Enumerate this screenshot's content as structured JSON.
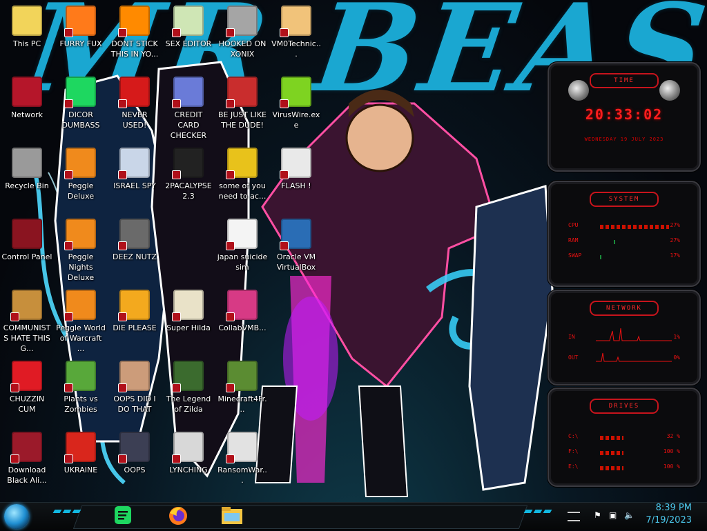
{
  "desktop": {
    "wallpaper_text": "MR BEAST",
    "icons": [
      {
        "label": "This PC",
        "icon": "this-pc-icon"
      },
      {
        "label": "FURRY FUX",
        "icon": "firefox-icon"
      },
      {
        "label": "DONT STICK THIS IN YO...",
        "icon": "vlc-icon"
      },
      {
        "label": "SEX EDITOR",
        "icon": "hex-editor-icon"
      },
      {
        "label": "HOOKED ON XONIX",
        "icon": "xonix-icon"
      },
      {
        "label": "VM0Technic...",
        "icon": "technician-icon"
      },
      {
        "label": "Network",
        "icon": "network-icon"
      },
      {
        "label": "DICOR DUMBASS",
        "icon": "discord-icon"
      },
      {
        "label": "NEVER USED!",
        "icon": "devcpp-icon"
      },
      {
        "label": "CREDIT CARD CHECKER",
        "icon": "credit-card-icon"
      },
      {
        "label": "BE JUST LIKE THE DUDE!",
        "icon": "santa-icon"
      },
      {
        "label": "VirusWire.exe",
        "icon": "lime-icon"
      },
      {
        "label": "Recycle Bin",
        "icon": "recycle-bin-icon"
      },
      {
        "label": "Peggle Deluxe",
        "icon": "peggle-icon"
      },
      {
        "label": "ISRAEL SPY",
        "icon": "spy-icon"
      },
      {
        "label": "2PACALYPSE 2.3",
        "icon": "console-icon"
      },
      {
        "label": "some of you need to ac...",
        "icon": "beaver-icon"
      },
      {
        "label": "FLASH !",
        "icon": "flash-icon"
      },
      {
        "label": "Control Panel",
        "icon": "control-panel-icon"
      },
      {
        "label": "Peggle Nights Deluxe",
        "icon": "peggle-icon"
      },
      {
        "label": "DEEZ NUTZ",
        "icon": "stack-icon"
      },
      {
        "label": "japan suicide sim",
        "icon": "document-icon"
      },
      {
        "label": "Oracle VM VirtualBox",
        "icon": "virtualbox-icon"
      },
      {
        "label": "COMMUNISTS HATE THIS G...",
        "icon": "money-bag-icon"
      },
      {
        "label": "Peggle World of Warcraft ...",
        "icon": "peggle-icon"
      },
      {
        "label": "DIE PLEASE",
        "icon": "de-icon"
      },
      {
        "label": "Super Hilda",
        "icon": "pixel-cat-icon"
      },
      {
        "label": "CollabVMB...",
        "icon": "monitor-icon"
      },
      {
        "label": "CHUZZIN CUM",
        "icon": "chuzzle-icon"
      },
      {
        "label": "Plants vs Zombies",
        "icon": "plant-icon"
      },
      {
        "label": "OOPS DID I DO THAT",
        "icon": "portrait-icon"
      },
      {
        "label": "The Legend of Zilda",
        "icon": "link-icon"
      },
      {
        "label": "Minecraft4Fr...",
        "icon": "grass-block-icon"
      },
      {
        "label": "Download Black Ali...",
        "icon": "alien-icon"
      },
      {
        "label": "UKRAINE",
        "icon": "radiation-icon"
      },
      {
        "label": "OOPS",
        "icon": "book-icon"
      },
      {
        "label": "LYNCHING",
        "icon": "network-tree-icon"
      },
      {
        "label": "RansomWar...",
        "icon": "skull-icon"
      }
    ]
  },
  "gadgets": {
    "time": {
      "title": "TIME",
      "clock": "20:33:02",
      "date": "WEDNESDAY 19 JULY 2023"
    },
    "system": {
      "title": "SYSTEM",
      "rows": [
        {
          "key": "CPU",
          "value": "27%"
        },
        {
          "key": "RAM",
          "value": "27%"
        },
        {
          "key": "SWAP",
          "value": "17%"
        }
      ]
    },
    "network": {
      "title": "NETWORK",
      "rows": [
        {
          "key": "IN",
          "value": "1%"
        },
        {
          "key": "OUT",
          "value": "0%"
        }
      ]
    },
    "drives": {
      "title": "DRIVES",
      "rows": [
        {
          "key": "C:\\",
          "value": "32 %"
        },
        {
          "key": "F:\\",
          "value": "100 %"
        },
        {
          "key": "E:\\",
          "value": "100 %"
        }
      ]
    }
  },
  "taskbar": {
    "pinned": [
      {
        "icon": "spotify-like-icon"
      },
      {
        "icon": "firefox-icon"
      },
      {
        "icon": "file-explorer-icon"
      }
    ],
    "clock_time": "8:39 PM",
    "clock_date": "7/19/2023",
    "colors": {
      "accent": "#12b7e0",
      "gadget_red": "#ff1d1d"
    }
  }
}
